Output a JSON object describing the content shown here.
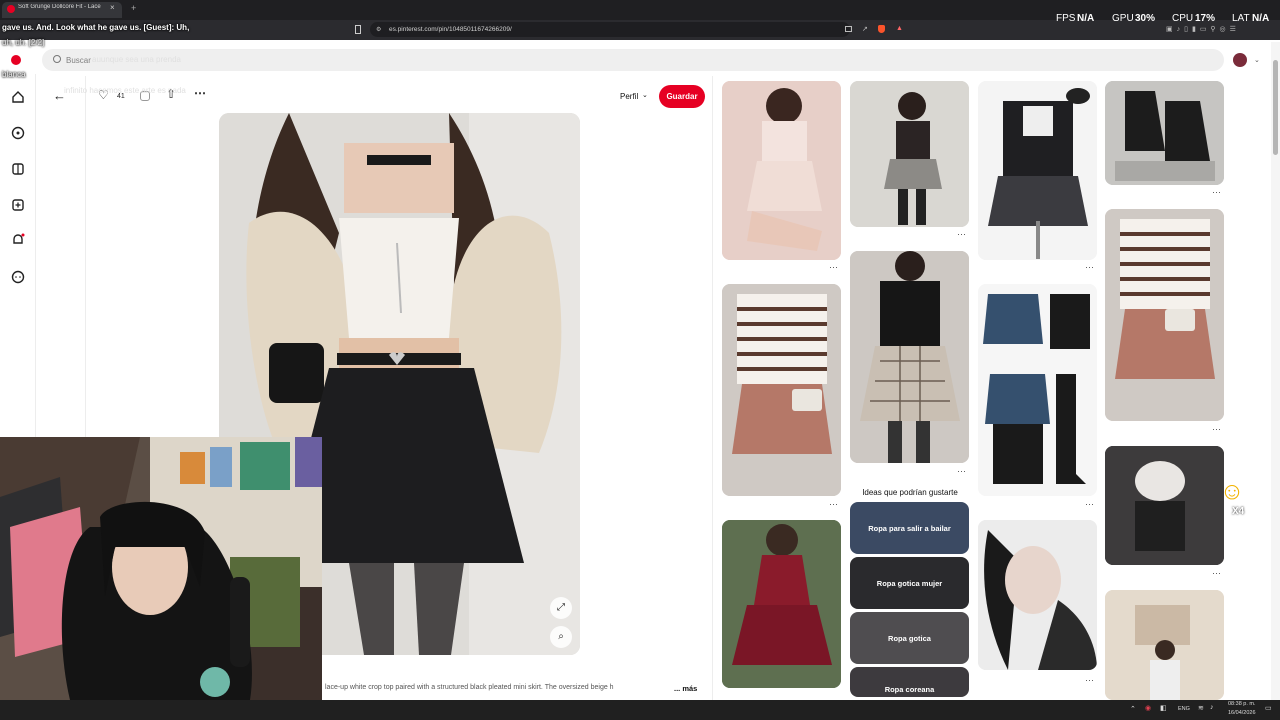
{
  "browser": {
    "tab_title": "Soft Grunge Dollcore Fit - Lace",
    "new_tab": "+",
    "url": "es.pinterest.com/pin/1048501167426620‌9/"
  },
  "overlay": {
    "fps_label": "FPS",
    "fps_value": "N/A",
    "gpu_label": "GPU",
    "gpu_value": "30%",
    "cpu_label": "CPU",
    "cpu_value": "17%",
    "lat_label": "LAT",
    "lat_value": "N/A"
  },
  "chat": {
    "line1": "gave us. And. Look what he gave us. [Guest]: Uh,",
    "line2": "uh, uh. [2/2]",
    "line3": "auunque sea una prenda",
    "line4": "blanca",
    "line5": "infinito hacemos este arte es nada"
  },
  "search": {
    "placeholder": "Buscar"
  },
  "pin": {
    "likes": "41",
    "profile_label": "Perfil",
    "save_label": "Guardar",
    "caption": "lace-up white crop top paired with a structured black pleated mini skirt. The oversized beige h",
    "more_label": "... más"
  },
  "related": {
    "ideas_title": "Ideas que podrían gustarte",
    "ideas": [
      "Ropa para salir a bailar",
      "Ropa gotica mujer",
      "Ropa gotica",
      "Ropa coreana"
    ]
  },
  "emote": {
    "count": "X4"
  },
  "taskbar": {
    "lang": "ENG",
    "time": "08:38 p. m.",
    "date": "16/04/2026"
  },
  "colors": {
    "pinterest_red": "#e60023",
    "browser_dark": "#1f1f22",
    "overlay_text": "#ffffff"
  }
}
